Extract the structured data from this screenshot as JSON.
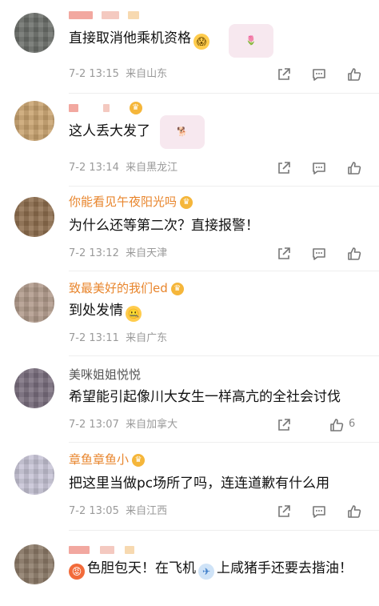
{
  "comments": [
    {
      "username": "",
      "username_style": "gray",
      "vip": false,
      "text": "直接取消他乘机资格",
      "emoji": "scream-emoji",
      "sticker": "tulip-sticker",
      "date": "7-2",
      "time": "13:15",
      "location": "来自山东",
      "likes": ""
    },
    {
      "username": "",
      "username_style": "gray",
      "vip": true,
      "text": "这人丢大发了",
      "emoji": "",
      "sticker": "doge-2023-sticker",
      "date": "7-2",
      "time": "13:14",
      "location": "来自黑龙江",
      "likes": ""
    },
    {
      "username": "你能看见午夜阳光吗",
      "username_style": "orange",
      "vip": true,
      "text": "为什么还等第二次？直接报警！",
      "emoji": "",
      "sticker": "",
      "date": "7-2",
      "time": "13:12",
      "location": "来自天津",
      "likes": ""
    },
    {
      "username": "致最美好的我们ed",
      "username_style": "orange",
      "vip": true,
      "text": "到处发情",
      "emoji": "zipper-mouth-emoji",
      "sticker": "",
      "date": "7-2",
      "time": "13:11",
      "location": "来自广东",
      "likes": ""
    },
    {
      "username": "美咪姐姐悦悦",
      "username_style": "gray",
      "vip": false,
      "text": "希望能引起像川大女生一样高亢的全社会讨伐",
      "emoji": "",
      "sticker": "",
      "date": "7-2",
      "time": "13:07",
      "location": "来自加拿大",
      "likes": "6"
    },
    {
      "username": "章鱼章鱼小",
      "username_style": "orange",
      "vip": true,
      "text": "把这里当做pc场所了吗，连连道歉有什么用",
      "emoji": "",
      "sticker": "",
      "date": "7-2",
      "time": "13:05",
      "location": "来自江西",
      "likes": ""
    },
    {
      "username": "",
      "username_style": "gray",
      "vip": false,
      "text_parts": [
        "色胆包天！在飞机",
        "上咸猪手还要去揩油！"
      ],
      "lead_emoji": "angry-emoji",
      "mid_emoji": "airplane-emoji"
    }
  ],
  "colors": {
    "orange_username": "#e8852c",
    "meta_gray": "#9a9a9a",
    "vip_badge": "#f5b63a"
  },
  "icons": [
    "share-icon",
    "comment-icon",
    "like-icon"
  ]
}
